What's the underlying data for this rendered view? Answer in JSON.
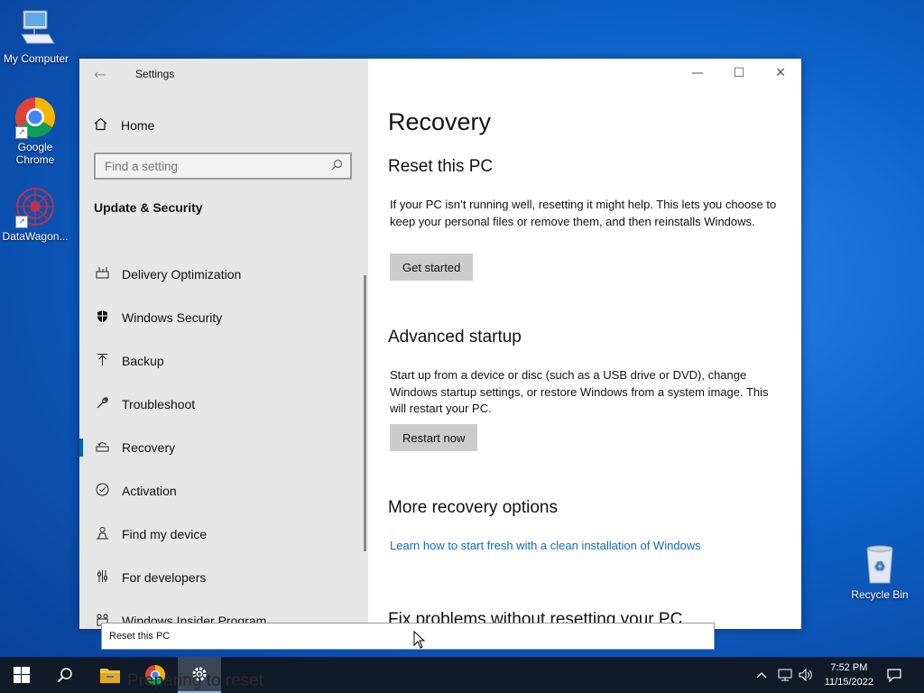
{
  "desktop": {
    "icons": [
      {
        "label": "My Computer"
      },
      {
        "label": "Google Chrome"
      },
      {
        "label": "DataWagon..."
      },
      {
        "label": "Recycle Bin"
      }
    ]
  },
  "window": {
    "title": "Settings",
    "controls": {
      "minimize": "—",
      "maximize": "☐",
      "close": "✕"
    }
  },
  "sidebar": {
    "home_label": "Home",
    "search_placeholder": "Find a setting",
    "section_title": "Update & Security",
    "items": [
      {
        "label": "Delivery Optimization",
        "icon": "delivery-optimization-icon"
      },
      {
        "label": "Windows Security",
        "icon": "shield-icon"
      },
      {
        "label": "Backup",
        "icon": "backup-arrow-icon"
      },
      {
        "label": "Troubleshoot",
        "icon": "wrench-icon"
      },
      {
        "label": "Recovery",
        "icon": "recovery-icon"
      },
      {
        "label": "Activation",
        "icon": "checkmark-circle-icon"
      },
      {
        "label": "Find my device",
        "icon": "person-location-icon"
      },
      {
        "label": "For developers",
        "icon": "developer-tools-icon"
      },
      {
        "label": "Windows Insider Program",
        "icon": "insider-icon"
      }
    ],
    "active": "Recovery"
  },
  "content": {
    "page_title": "Recovery",
    "reset": {
      "heading": "Reset this PC",
      "description": "If your PC isn’t running well, resetting it might help. This lets you choose to keep your personal files or remove them, and then reinstalls Windows.",
      "button": "Get started"
    },
    "advanced": {
      "heading": "Advanced startup",
      "description": "Start up from a device or disc (such as a USB drive or DVD), change Windows startup settings, or restore Windows from a system image. This will restart your PC.",
      "button": "Restart now"
    },
    "more": {
      "heading": "More recovery options",
      "link": "Learn how to start fresh with a clean installation of Windows"
    },
    "fix": {
      "heading": "Fix problems without resetting your PC"
    }
  },
  "tooltip": {
    "text": "Reset this PC"
  },
  "ghost_text": "Preparing to reset",
  "taskbar": {
    "time": "7:52 PM",
    "date": "11/15/2022"
  },
  "colors": {
    "accent": "#0063b1",
    "link": "#0a6cbd",
    "sidebar_bg": "#e6e6e6"
  }
}
